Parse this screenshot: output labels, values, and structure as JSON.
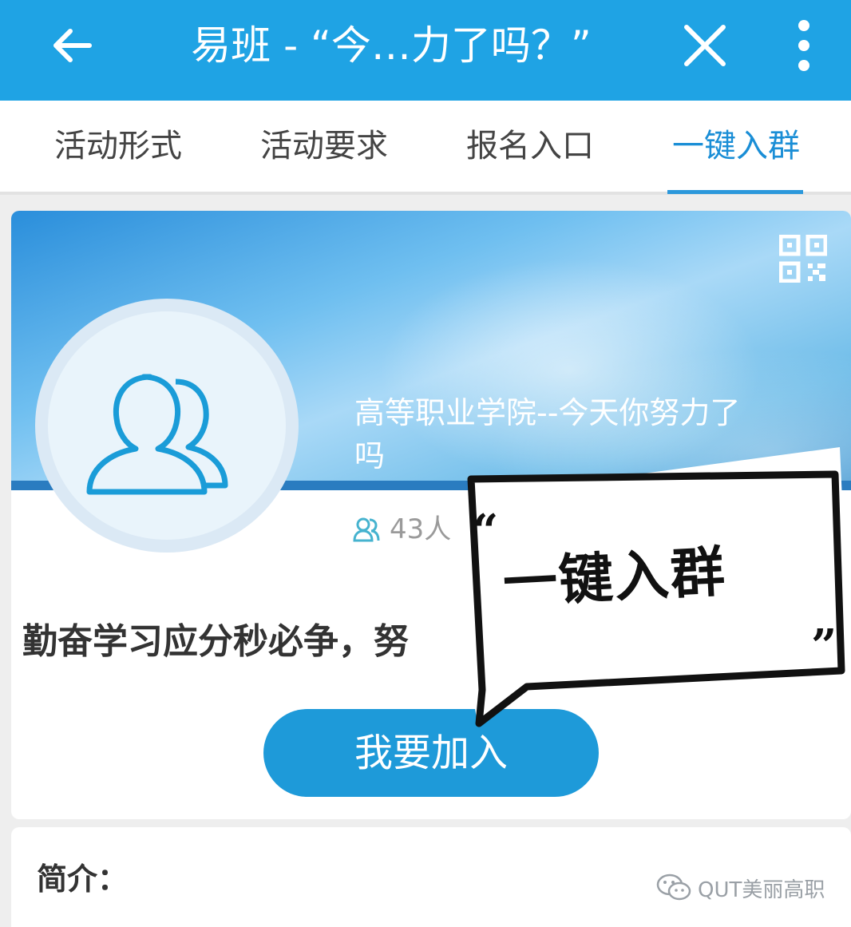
{
  "appbar": {
    "title": "易班 - “今…力了吗？”",
    "icons": [
      "back-arrow-icon",
      "close-icon",
      "more-vertical-icon"
    ]
  },
  "tabs": [
    {
      "label": "活动形式",
      "active": false
    },
    {
      "label": "活动要求",
      "active": false
    },
    {
      "label": "报名入口",
      "active": false
    },
    {
      "label": "一键入群",
      "active": true
    }
  ],
  "group": {
    "name": "高等职业学院--今天你努力了吗",
    "members": "43人",
    "slogan": "勤奋学习应分秒必争，努",
    "join_label": "我要加入"
  },
  "bubble": {
    "text": "一键入群",
    "open_quote": "“",
    "close_quote": "”"
  },
  "intro": {
    "label": "简介："
  },
  "watermark": {
    "text": "QUT美丽高职"
  },
  "colors": {
    "brand": "#1fa3e4",
    "tab_active": "#1a8ed6",
    "button": "#1e9ad9"
  }
}
